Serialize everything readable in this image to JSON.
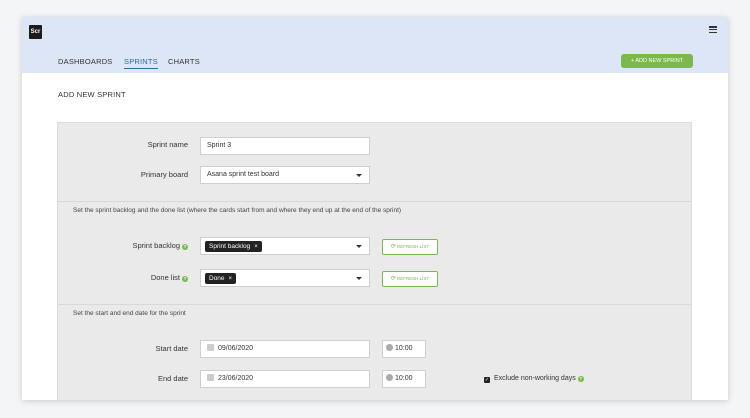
{
  "header": {
    "logo_text": "Scr",
    "nav": [
      {
        "label": "DASHBOARDS"
      },
      {
        "label": "SPRINTS"
      },
      {
        "label": "CHARTS"
      }
    ],
    "add_button_label": "+ ADD NEW SPRINT"
  },
  "page": {
    "title": "ADD NEW SPRINT"
  },
  "form": {
    "sprint_name": {
      "label": "Sprint name",
      "value": "Sprint 3"
    },
    "primary_board": {
      "label": "Primary board",
      "value": "Asana sprint test board"
    },
    "backlog_section_text": "Set the sprint backlog and the done list (where the cards start from and where they end up at the end of the sprint)",
    "sprint_backlog": {
      "label": "Sprint backlog",
      "tag": "Sprint backlog",
      "remove": "×"
    },
    "done_list": {
      "label": "Done list",
      "tag": "Done",
      "remove": "×"
    },
    "refresh_label": "REFRESH LIST",
    "date_section_text": "Set the start and end date for the sprint",
    "start_date": {
      "label": "Start date",
      "date": "09/06/2020",
      "time": "10:00"
    },
    "end_date": {
      "label": "End date",
      "date": "23/06/2020",
      "time": "10:00"
    },
    "exclude_label": "Exclude non-working days",
    "help_glyph": "?"
  },
  "colors": {
    "header_bg": "#dce6f6",
    "accent_green": "#7ab94a",
    "active_nav": "#2d6a94",
    "panel_bg": "#eaeaea"
  }
}
